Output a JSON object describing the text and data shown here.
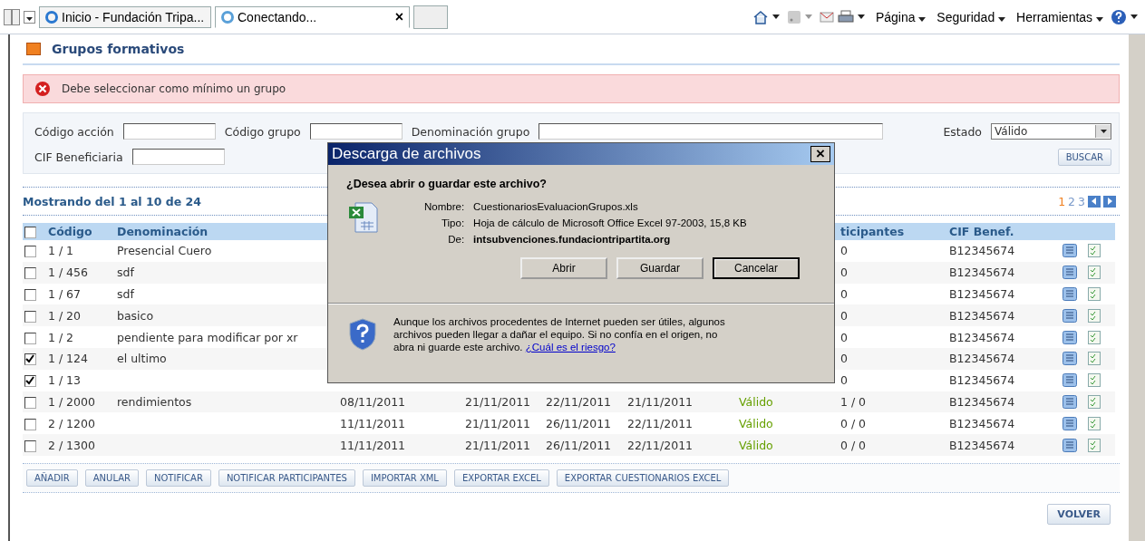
{
  "browser": {
    "tabs": [
      {
        "title": "Inicio - Fundación Tripa...",
        "kind": "ie",
        "selected": false
      },
      {
        "title": "Conectando...",
        "kind": "loading",
        "selected": true
      }
    ],
    "close_tab": "×",
    "menus": [
      "Página",
      "Seguridad",
      "Herramientas"
    ]
  },
  "section_title": "Grupos formativos",
  "error": "Debe seleccionar como mínimo un grupo",
  "filters": {
    "codigo_accion": {
      "label": "Código acción"
    },
    "codigo_grupo": {
      "label": "Código grupo"
    },
    "denominacion_grupo": {
      "label": "Denominación grupo"
    },
    "estado": {
      "label": "Estado",
      "value": "Válido"
    },
    "cif": {
      "label": "CIF Beneficiaria"
    },
    "search_button": "BUSCAR"
  },
  "results": "Mostrando del 1 al 10 de 24",
  "pages": [
    {
      "label": "1",
      "selected": true
    },
    {
      "label": "2",
      "selected": false
    },
    {
      "label": "3",
      "selected": false
    }
  ],
  "table": {
    "select_all": false,
    "columns": {
      "codigo": "Código",
      "denominacion": "Denominación",
      "participantes": "ticipantes",
      "cif": "CIF Benef."
    },
    "rows": [
      {
        "checked": false,
        "codigo": "1 / 1",
        "denominacion": "Presencial Cuero",
        "participantes": "0",
        "cif": "B12345674"
      },
      {
        "checked": false,
        "codigo": "1 / 456",
        "denominacion": "sdf",
        "participantes": "0",
        "cif": "B12345674"
      },
      {
        "checked": false,
        "codigo": "1 / 67",
        "denominacion": "sdf",
        "participantes": "0",
        "cif": "B12345674"
      },
      {
        "checked": false,
        "codigo": "1 / 20",
        "denominacion": "basico",
        "participantes": "0",
        "cif": "B12345674"
      },
      {
        "checked": false,
        "codigo": "1 / 2",
        "denominacion": "pendiente para modificar por xr",
        "participantes": "0",
        "cif": "B12345674"
      },
      {
        "checked": true,
        "codigo": "1 / 124",
        "denominacion": "el ultimo",
        "participantes": "0",
        "cif": "B12345674"
      },
      {
        "checked": true,
        "codigo": "1 / 13",
        "participantes": "0",
        "cif": "B12345674"
      },
      {
        "checked": false,
        "codigo": "1 / 2000",
        "denominacion": "rendimientos",
        "fecha_1": "08/11/2011",
        "fecha_2": "21/11/2011",
        "fecha_3": "22/11/2011",
        "fecha_4": "21/11/2011",
        "estado": "Válido",
        "participantes": "1 / 0",
        "cif": "B12345674"
      },
      {
        "checked": false,
        "codigo": "2 / 1200",
        "fecha_1": "11/11/2011",
        "fecha_2": "21/11/2011",
        "fecha_3": "26/11/2011",
        "fecha_4": "22/11/2011",
        "estado": "Válido",
        "participantes": "0 / 0",
        "cif": "B12345674"
      },
      {
        "checked": false,
        "codigo": "2 / 1300",
        "fecha_1": "11/11/2011",
        "fecha_2": "21/11/2011",
        "fecha_3": "26/11/2011",
        "fecha_4": "22/11/2011",
        "estado": "Válido",
        "participantes": "0 / 0",
        "cif": "B12345674"
      }
    ]
  },
  "actions": [
    "AÑADIR",
    "ANULAR",
    "NOTIFICAR",
    "NOTIFICAR PARTICIPANTES",
    "IMPORTAR XML",
    "EXPORTAR EXCEL",
    "EXPORTAR CUESTIONARIOS EXCEL"
  ],
  "back_button": "VOLVER",
  "dialog": {
    "title": "Descarga de archivos",
    "close": "×",
    "question": "¿Desea abrir o guardar este archivo?",
    "fields": [
      {
        "label": "Nombre:",
        "value": "CuestionariosEvaluacionGrupos.xls",
        "bold": false
      },
      {
        "label": "Tipo:",
        "value": "Hoja de cálculo de Microsoft Office Excel 97-2003, 15,8 KB",
        "bold": false
      },
      {
        "label": "De:",
        "value": "intsubvenciones.fundaciontripartita.org",
        "bold": true
      }
    ],
    "buttons": [
      {
        "label": "Abrir",
        "default": false
      },
      {
        "label": "Guardar",
        "default": false
      },
      {
        "label": "Cancelar",
        "default": true
      }
    ],
    "warning": "Aunque los archivos procedentes de Internet pueden ser útiles, algunos archivos pueden llegar a dañar el equipo. Si no confía en el origen, no abra ni guarde este archivo.",
    "risk_link": "¿Cuál es el riesgo?"
  }
}
